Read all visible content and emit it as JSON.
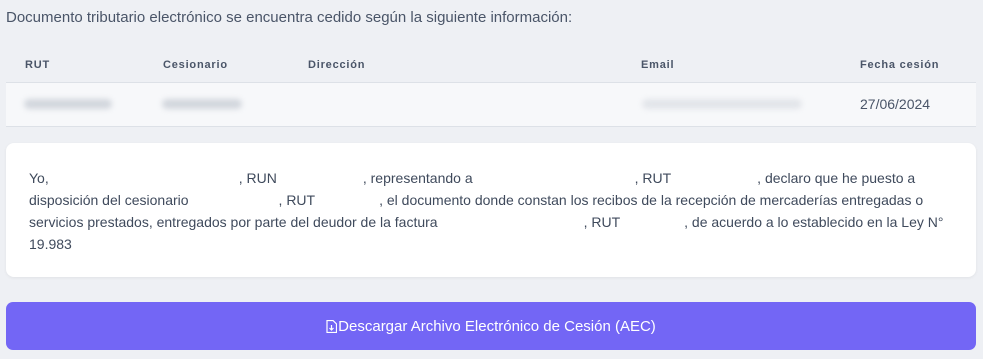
{
  "intro_text": "Documento tributario electrónico se encuentra cedido según la siguiente información:",
  "table": {
    "headers": {
      "rut": "RUT",
      "cesionario": "Cesionario",
      "direccion": "Dirección",
      "email": "Email",
      "fecha": "Fecha cesión"
    },
    "row": {
      "fecha": "27/06/2024"
    }
  },
  "declaration": {
    "yo": "Yo,",
    "run": ", RUN",
    "representando": ", representando a",
    "rut1": ", RUT",
    "declaro": ", declaro que he puesto a disposición del cesionario",
    "rut2": ", RUT",
    "documento": ", el documento donde constan los recibos de la recepción de mercaderías entregadas o servicios prestados, entregados por parte del deudor de la factura",
    "rut3": ", RUT",
    "acuerdo": ", de acuerdo a lo establecido en la Ley N° 19.983"
  },
  "download_button": {
    "label": "Descargar Archivo Electrónico de Cesión (AEC)",
    "icon": "file-download-icon",
    "color": "#7366f5"
  }
}
